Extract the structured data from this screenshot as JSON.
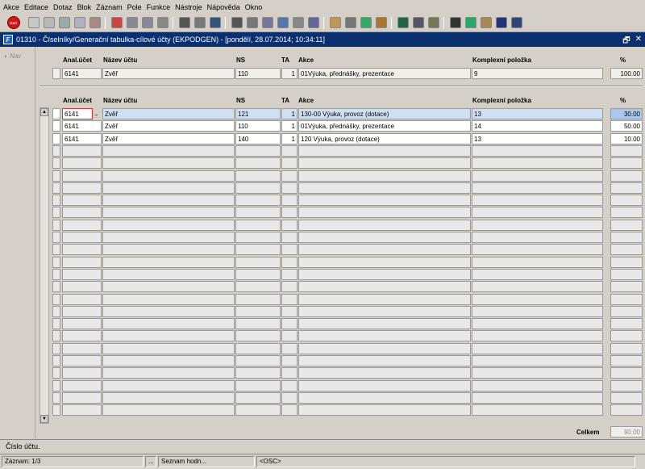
{
  "menu": [
    "Akce",
    "Editace",
    "Dotaz",
    "Blok",
    "Záznam",
    "Pole",
    "Funkce",
    "Nástroje",
    "Nápověda",
    "Okno"
  ],
  "toolbar": {
    "exit_label": "EXIT",
    "icons": [
      "save-icon",
      "print-icon",
      "check-icon",
      "copy-icon",
      "delete-record-icon",
      "delete-icon",
      "sort-asc-icon",
      "sort-desc-icon",
      "filter-icon",
      "printer-icon",
      "print-preview-icon",
      "mail-icon",
      "cut-icon",
      "execute-icon",
      "clone-icon",
      "find-icon",
      "list-icon",
      "columns-icon",
      "calculator-icon",
      "report-icon",
      "globe-icon",
      "tools-icon",
      "warning-icon",
      "query-icon",
      "attach-icon",
      "sum-icon",
      "excel-icon",
      "user-icon",
      "help-icon",
      "info-icon"
    ]
  },
  "window": {
    "icon_label": "F",
    "title": "01310 - Číselníky/Generační tabulka-cílové účty (EKPODGEN) - [pondělí, 28.07.2014; 10:34:11]",
    "restore": "🗗",
    "close": "✕"
  },
  "nav": {
    "label": "Nav"
  },
  "header_block": {
    "columns": {
      "anal": "Anal.účet",
      "nazev": "Název účtu",
      "ns": "NS",
      "ta": "TA",
      "akce": "Akce",
      "komplex": "Komplexní položka",
      "pct": "%"
    },
    "row": {
      "anal": "6141",
      "nazev": "Zvěř",
      "ns": "110",
      "ta": "1",
      "akce": "01Výuka, přednášky, prezentace",
      "komplex": "9",
      "pct": "100.00"
    }
  },
  "detail_block": {
    "columns": {
      "anal": "Anal.účet",
      "nazev": "Název účtu",
      "ns": "NS",
      "ta": "TA",
      "akce": "Akce",
      "komplex": "Komplexní položka",
      "pct": "%"
    },
    "rows": [
      {
        "anal": "6141",
        "nazev": "Zvěř",
        "ns": "121",
        "ta": "1",
        "akce": "130-00 Výuka, provoz (dotace)",
        "komplex": "13",
        "pct": "30.00"
      },
      {
        "anal": "6141",
        "nazev": "Zvěř",
        "ns": "110",
        "ta": "1",
        "akce": "01Výuka, přednášky, prezentace",
        "komplex": "14",
        "pct": "50.00"
      },
      {
        "anal": "6141",
        "nazev": "Zvěř",
        "ns": "140",
        "ta": "1",
        "akce": "120 Výuka, provoz (dotace)",
        "komplex": "13",
        "pct": "10.00"
      }
    ],
    "lov_button": "...",
    "total_label": "Celkem",
    "total_value": "90.00"
  },
  "status": {
    "hint": "Číslo účtu.",
    "record": "Záznam: 1/3",
    "ellipsis": "...",
    "list": "Seznam hodn...",
    "mode": "<OSC>"
  }
}
